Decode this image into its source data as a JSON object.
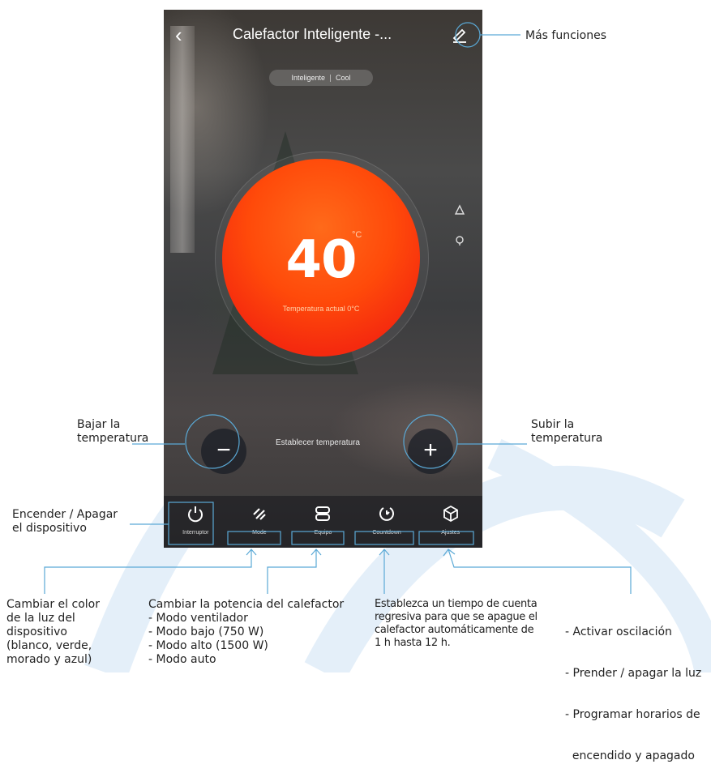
{
  "app": {
    "title": "Calefactor Inteligente -...",
    "mode_pill": {
      "left": "Inteligente",
      "right": "Cool"
    },
    "temperature": {
      "value": "40",
      "unit": "°C",
      "current": "Temperatura actual 0°C"
    },
    "set_temp_label": "Establecer temperatura",
    "minus_label": "−",
    "plus_label": "+",
    "bottom_bar": [
      {
        "label": "Interruptor",
        "icon": "power-icon"
      },
      {
        "label": "Mode",
        "icon": "slashes-icon"
      },
      {
        "label": "Equipo",
        "icon": "stack-icon"
      },
      {
        "label": "Countdown",
        "icon": "timer-icon"
      },
      {
        "label": "Ajustes",
        "icon": "cube-icon"
      }
    ],
    "side_icons": [
      "triangle-icon",
      "bulb-icon"
    ]
  },
  "annotations": {
    "more_functions": "Más funciones",
    "lower_temp": [
      "Bajar la",
      "temperatura"
    ],
    "raise_temp": [
      "Subir la",
      "temperatura"
    ],
    "power": [
      "Encender / Apagar",
      "el dispositivo"
    ],
    "light_color": [
      "Cambiar el color",
      "de la luz del",
      "dispositivo",
      "(blanco, verde,",
      "morado y azul)"
    ],
    "power_level": [
      "Cambiar la potencia del calefactor",
      "- Modo ventilador",
      "- Modo bajo (750 W)",
      "- Modo alto (1500 W)",
      "- Modo auto"
    ],
    "countdown": [
      "Establezca un tiempo de cuenta",
      "regresiva para que se apague el",
      "calefactor automáticamente de",
      "1 h  hasta 12 h."
    ],
    "settings": [
      "- Activar oscilación",
      "- Prender / apagar la luz",
      "- Programar horarios de",
      "  encendido y apagado"
    ]
  },
  "colors": {
    "accent_line": "#5aa9d6",
    "temp_orange": "#ff4a0a",
    "bg_arc": "#e4eff9"
  }
}
